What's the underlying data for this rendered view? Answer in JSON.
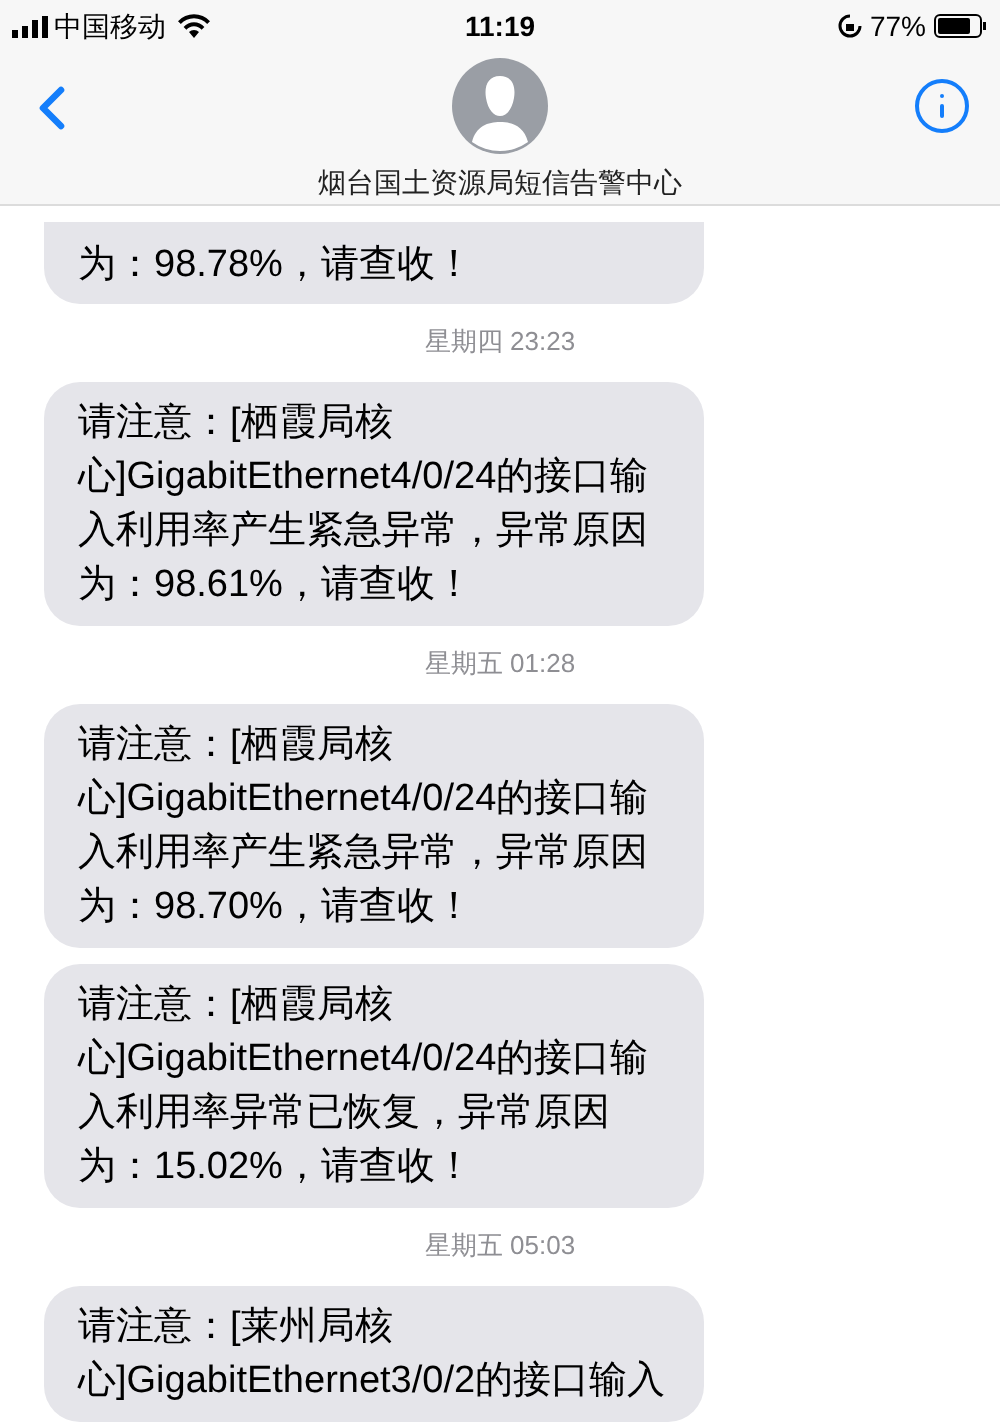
{
  "status_bar": {
    "carrier": "中国移动",
    "time": "11:19",
    "battery": "77%"
  },
  "header": {
    "contact": "烟台国土资源局短信告警中心"
  },
  "messages": [
    {
      "kind": "bubble",
      "text": "为：98.78%，请查收！"
    },
    {
      "kind": "date",
      "text": "星期四 23:23"
    },
    {
      "kind": "bubble",
      "text": "请注意：[栖霞局核心]GigabitEthernet4/0/24的接口输入利用率产生紧急异常，异常原因为：98.61%，请查收！"
    },
    {
      "kind": "date",
      "text": "星期五 01:28"
    },
    {
      "kind": "bubble",
      "text": "请注意：[栖霞局核心]GigabitEthernet4/0/24的接口输入利用率产生紧急异常，异常原因为：98.70%，请查收！"
    },
    {
      "kind": "bubble",
      "text": "请注意：[栖霞局核心]GigabitEthernet4/0/24的接口输入利用率异常已恢复，异常原因为：15.02%，请查收！"
    },
    {
      "kind": "date",
      "text": "星期五 05:03"
    },
    {
      "kind": "bubble",
      "text": "请注意：[莱州局核心]GigabitEthernet3/0/2的接口输入"
    }
  ]
}
